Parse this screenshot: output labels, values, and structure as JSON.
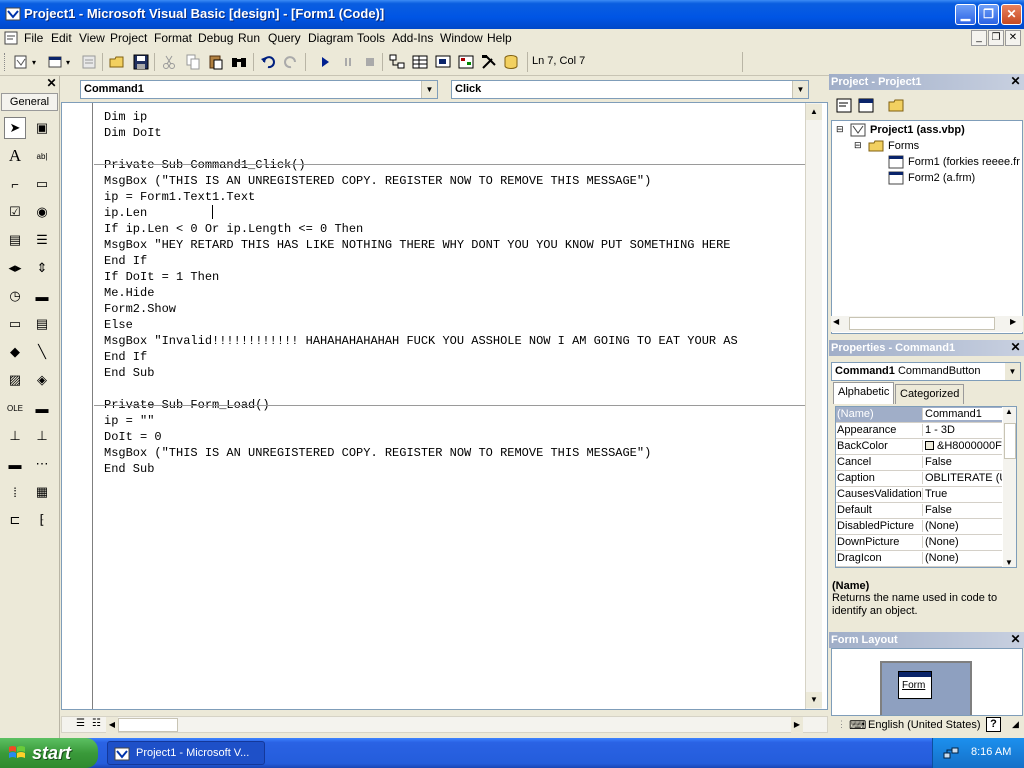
{
  "window": {
    "title": "Project1 - Microsoft Visual Basic [design] - [Form1 (Code)]",
    "min_glyph": "▁",
    "max_glyph": "❐",
    "close_glyph": "✕"
  },
  "menu": [
    "File",
    "Edit",
    "View",
    "Project",
    "Format",
    "Debug",
    "Run",
    "Query",
    "Diagram",
    "Tools",
    "Add-Ins",
    "Window",
    "Help"
  ],
  "mdi_controls": {
    "min": "_",
    "restore": "❐",
    "close": "✕"
  },
  "toolbar": {
    "position": "Ln 7, Col 7",
    "icons": [
      "add-project-icon",
      "add-form-icon",
      "menu-editor-icon",
      "open-icon",
      "save-icon",
      "cut-icon",
      "copy-icon",
      "paste-icon",
      "find-icon",
      "undo-icon",
      "redo-icon",
      "start-icon",
      "break-icon",
      "end-icon",
      "project-explorer-icon",
      "properties-icon",
      "form-layout-icon",
      "object-browser-icon",
      "toolbox-icon",
      "data-view-icon"
    ]
  },
  "toolbox": {
    "tab": "General",
    "close": "✕",
    "tools": [
      "pointer",
      "picturebox",
      "label",
      "textbox",
      "frame",
      "commandbutton",
      "checkbox",
      "optionbutton",
      "combobox",
      "listbox",
      "hscrollbar",
      "vscrollbar",
      "timer",
      "drivelistbox",
      "dirlistbox",
      "filelistbox",
      "shape",
      "line",
      "image",
      "data",
      "ole",
      "extra-1",
      "extra-2",
      "extra-3",
      "extra-4",
      "extra-5",
      "extra-6",
      "extra-7",
      "extra-8",
      "extra-9"
    ]
  },
  "code_window": {
    "object_combo": "Command1",
    "procedure_combo": "Click",
    "code": "Dim ip\nDim DoIt\n\nPrivate Sub Command1_Click()\nMsgBox (\"THIS IS AN UNREGISTERED COPY. REGISTER NOW TO REMOVE THIS MESSAGE\")\nip = Form1.Text1.Text\nip.Len\nIf ip.Len < 0 Or ip.Length <= 0 Then\nMsgBox \"HEY RETARD THIS HAS LIKE NOTHING THERE WHY DONT YOU YOU KNOW PUT SOMETHING HERE\nEnd If\nIf DoIt = 1 Then\nMe.Hide\nForm2.Show\nElse\nMsgBox \"Invalid!!!!!!!!!!!! HAHAHAHAHAHAH FUCK YOU ASSHOLE NOW I AM GOING TO EAT YOUR AS\nEnd If\nEnd Sub\n\nPrivate Sub Form_Load()\nip = \"\"\nDoIt = 0\nMsgBox (\"THIS IS AN UNREGISTERED COPY. REGISTER NOW TO REMOVE THIS MESSAGE\")\nEnd Sub"
  },
  "project": {
    "title": "Project - Project1",
    "close": "✕",
    "root": "Project1 (ass.vbp)",
    "folder": "Forms",
    "items": [
      "Form1 (forkies reeee.fr",
      "Form2 (a.frm)"
    ]
  },
  "properties": {
    "title": "Properties - Command1",
    "close": "✕",
    "object": "Command1",
    "object_type": "CommandButton",
    "tabs": [
      "Alphabetic",
      "Categorized"
    ],
    "rows": [
      {
        "k": "(Name)",
        "v": "Command1"
      },
      {
        "k": "Appearance",
        "v": "1 - 3D"
      },
      {
        "k": "BackColor",
        "v": "&H8000000F"
      },
      {
        "k": "Cancel",
        "v": "False"
      },
      {
        "k": "Caption",
        "v": "OBLITERATE (UI"
      },
      {
        "k": "CausesValidation",
        "v": "True"
      },
      {
        "k": "Default",
        "v": "False"
      },
      {
        "k": "DisabledPicture",
        "v": "(None)"
      },
      {
        "k": "DownPicture",
        "v": "(None)"
      },
      {
        "k": "DragIcon",
        "v": "(None)"
      }
    ],
    "desc_name": "(Name)",
    "desc_text": "Returns the name used in code to identify an object."
  },
  "form_layout": {
    "title": "Form Layout",
    "close": "✕",
    "form_label": "Form"
  },
  "language_bar": {
    "label": "English (United States)",
    "help": "?"
  },
  "taskbar": {
    "start": "start",
    "task": "Project1 - Microsoft V...",
    "clock": "8:16 AM"
  },
  "colors": {
    "title_blue": "#0055e5",
    "start_green": "#3a9a3a",
    "panel_inactive": "#a0aec8"
  }
}
